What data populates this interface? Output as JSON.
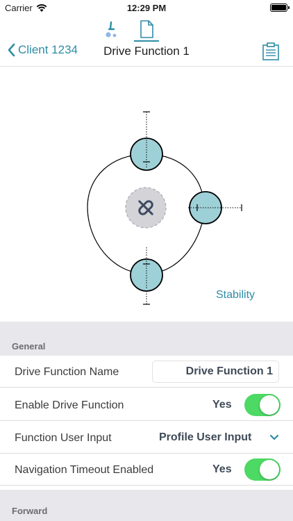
{
  "status_bar": {
    "carrier": "Carrier",
    "time": "12:29 PM"
  },
  "mode_tabs": {
    "icons": [
      "wheelchair-icon",
      "document-icon"
    ],
    "active": "document-icon"
  },
  "nav": {
    "back_label": "Client 1234",
    "title": "Drive Function 1"
  },
  "diagram": {
    "link_label": "Stability"
  },
  "sections": {
    "general": "General",
    "forward": "Forward"
  },
  "rows": [
    {
      "label": "Drive Function Name",
      "value": "Drive Function 1"
    },
    {
      "label": "Enable Drive Function",
      "value": "Yes",
      "toggle": true
    },
    {
      "label": "Function User Input",
      "value": "Profile User Input"
    },
    {
      "label": "Navigation Timeout Enabled",
      "value": "Yes",
      "toggle": true
    }
  ],
  "colors": {
    "accent": "#2e8ca6",
    "toggle_on": "#4cd964",
    "wheel_fill": "#9ed0d7",
    "section_bg": "#e7e7ec"
  }
}
